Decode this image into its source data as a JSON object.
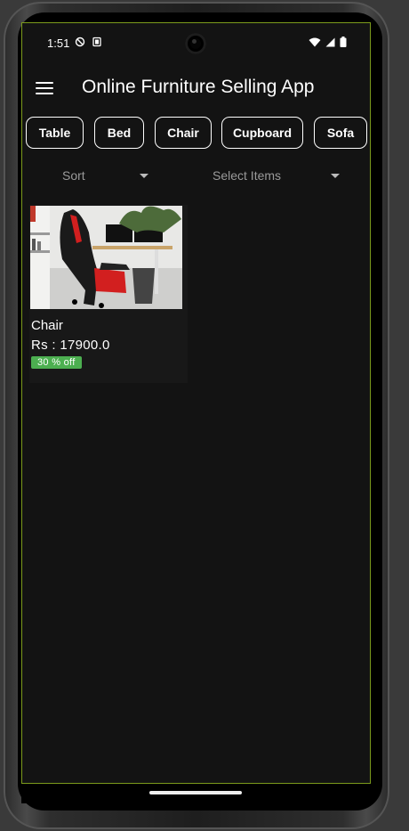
{
  "status_bar": {
    "time": "1:51",
    "left_icons": [
      "data-saver-icon",
      "screenshot-icon"
    ],
    "right_icons": [
      "wifi-icon",
      "cellular-signal-icon",
      "battery-icon"
    ]
  },
  "app_bar": {
    "menu_icon": "hamburger-menu-icon",
    "title": "Online Furniture Selling App"
  },
  "categories": [
    "Table",
    "Bed",
    "Chair",
    "Cupboard",
    "Sofa"
  ],
  "filters": {
    "sort": {
      "label": "Sort",
      "icon": "caret-down-icon"
    },
    "select_items": {
      "label": "Select Items",
      "icon": "caret-down-icon"
    }
  },
  "products": [
    {
      "name": "Chair",
      "price": "Rs : 17900.0",
      "discount": "30 % off",
      "image": "red-black-gaming-chair-photo"
    }
  ],
  "colors": {
    "background": "#131313",
    "text": "#ffffff",
    "muted_text": "#9a9a9a",
    "badge": "#4caf50",
    "screen_outline": "#7c9b1c"
  }
}
